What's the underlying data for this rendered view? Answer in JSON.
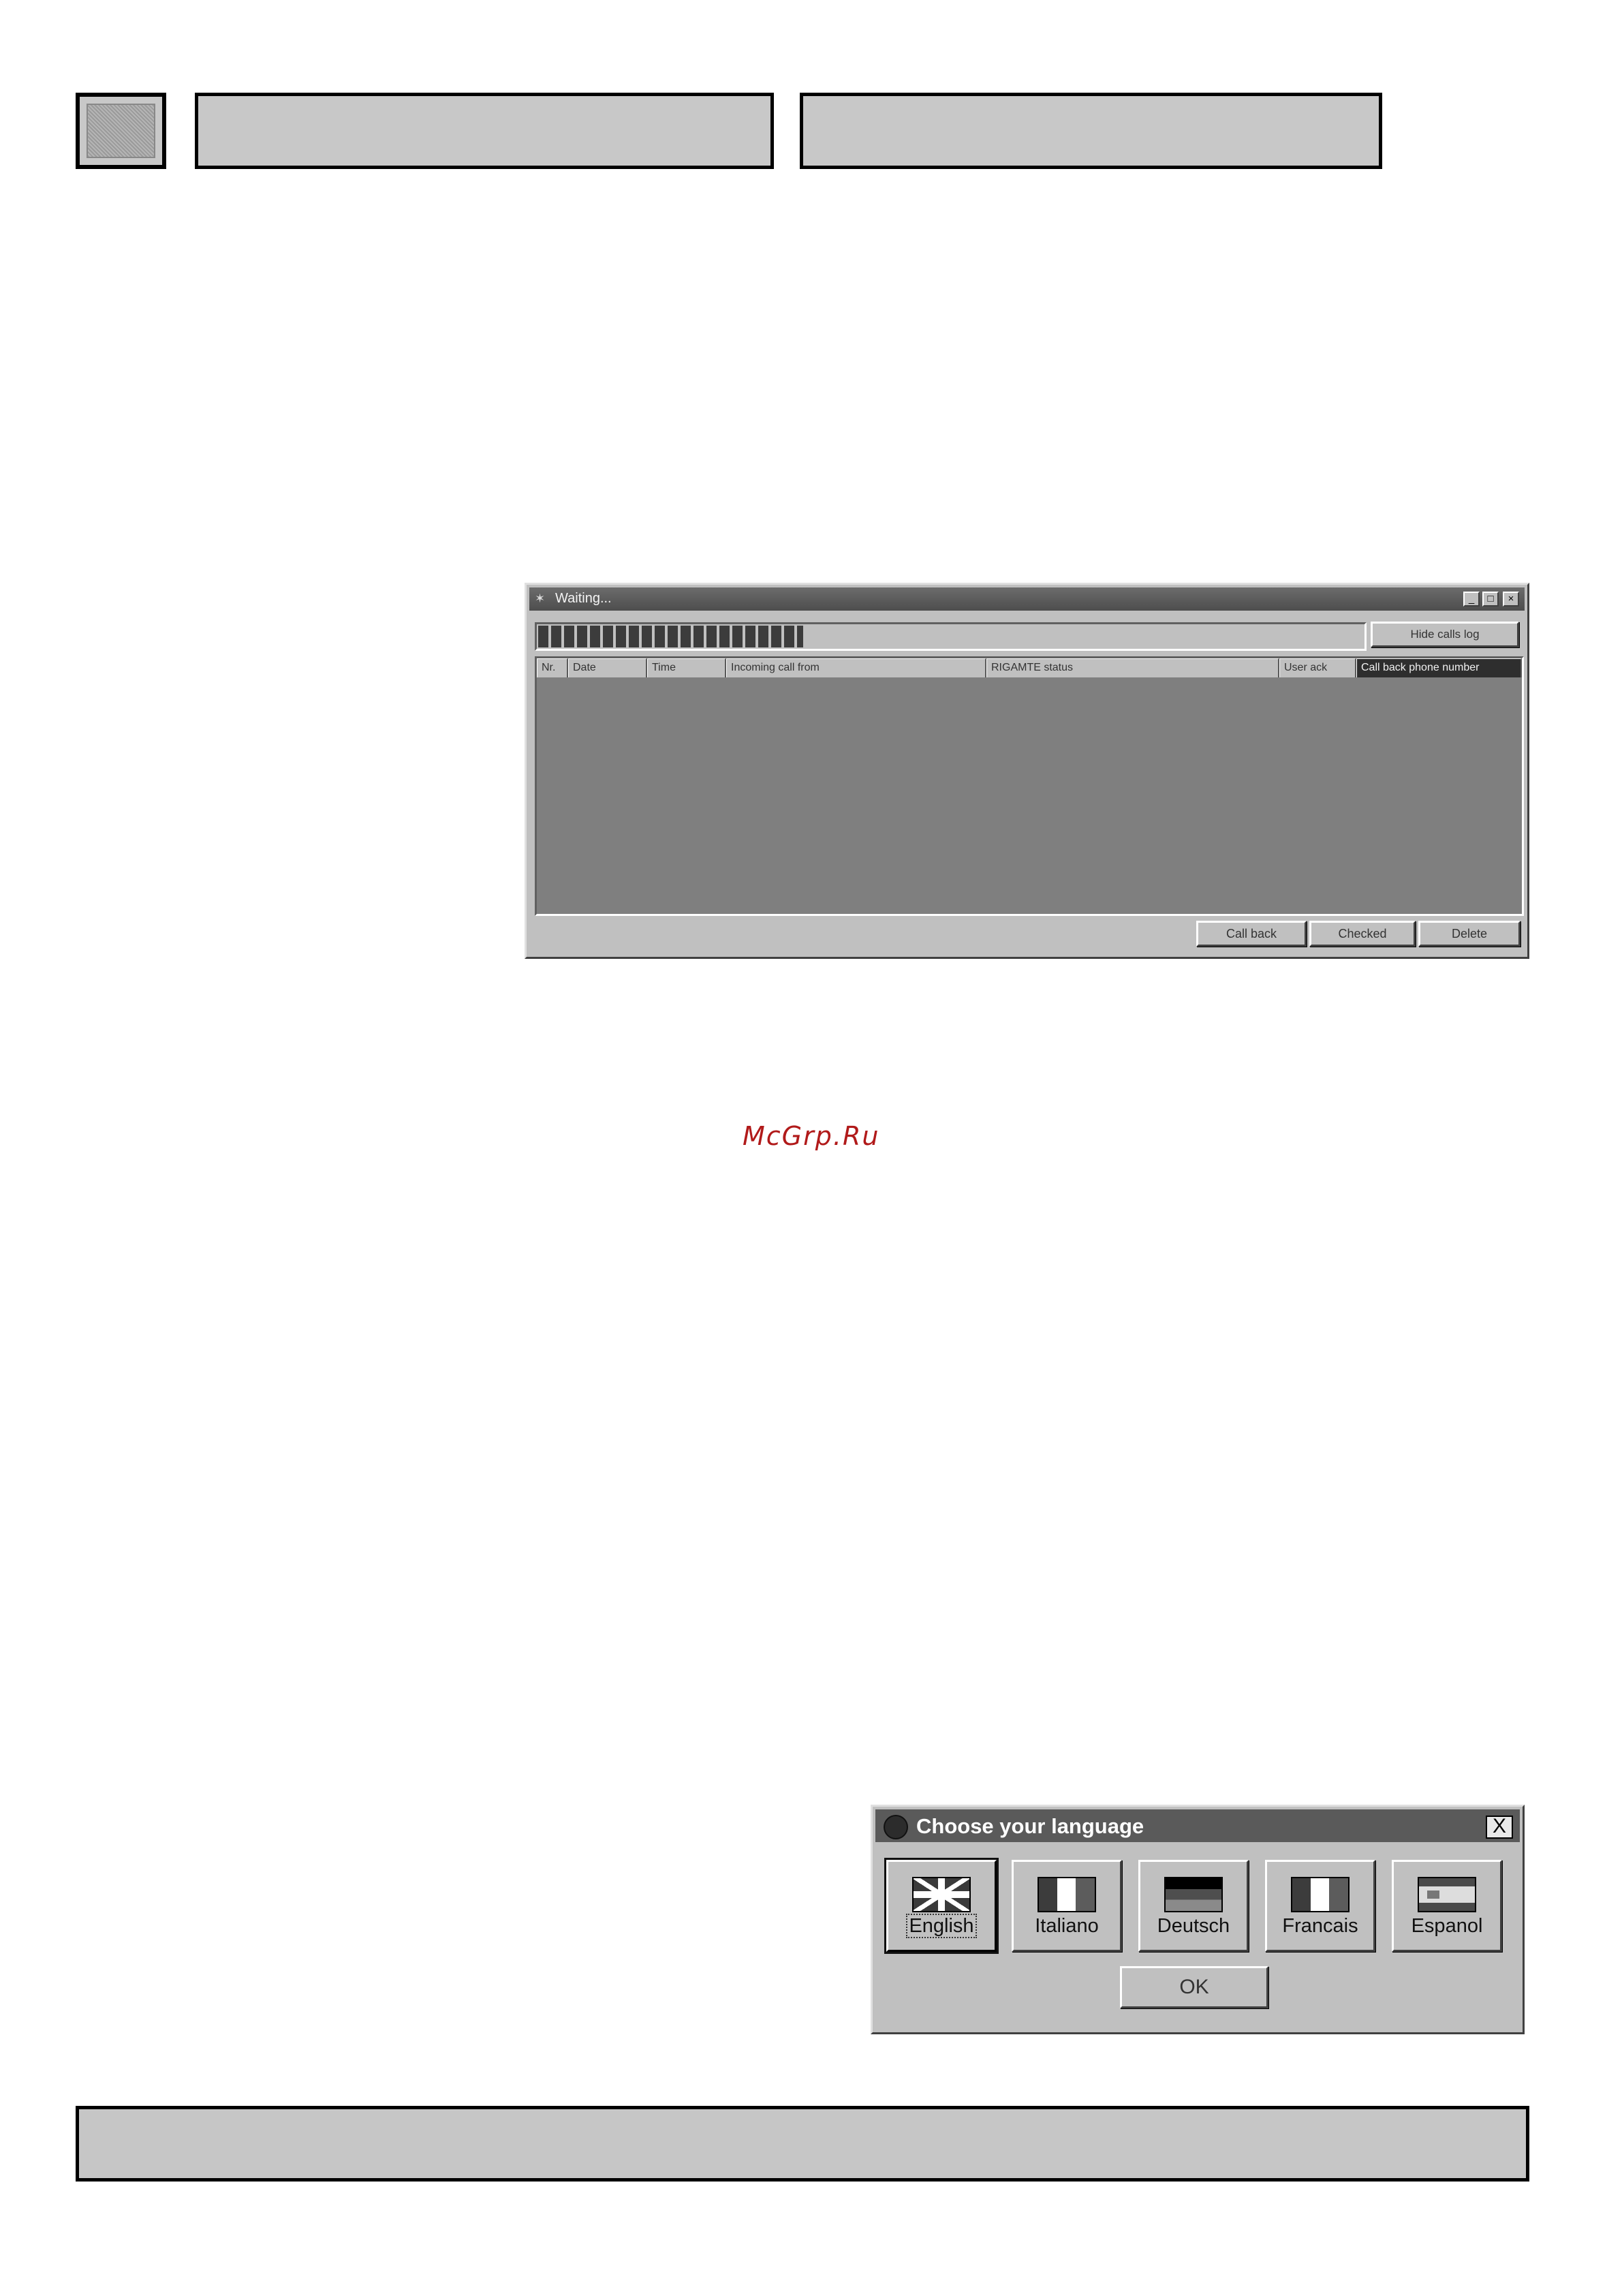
{
  "waiting_window": {
    "title": "Waiting...",
    "progress_fraction": 0.32,
    "hide_button": "Hide calls log",
    "columns": [
      "Nr.",
      "Date",
      "Time",
      "Incoming call from",
      "RIGAMTE status",
      "User ack",
      "Call back phone number"
    ],
    "active_column": 6,
    "buttons": {
      "call_back": "Call back",
      "checked": "Checked",
      "delete": "Delete"
    },
    "controls": {
      "minimize": "_",
      "maximize": "□",
      "close": "×"
    }
  },
  "language_dialog": {
    "title": "Choose your language",
    "close": "X",
    "languages": [
      {
        "label": "English",
        "flag": "flag-uk-icon",
        "selected": true
      },
      {
        "label": "Italiano",
        "flag": "flag-it-icon",
        "selected": false
      },
      {
        "label": "Deutsch",
        "flag": "flag-de-icon",
        "selected": false
      },
      {
        "label": "Francais",
        "flag": "flag-fr-icon",
        "selected": false
      },
      {
        "label": "Espanol",
        "flag": "flag-es-icon",
        "selected": false
      }
    ],
    "ok": "OK"
  },
  "watermark": "McGrp.Ru"
}
